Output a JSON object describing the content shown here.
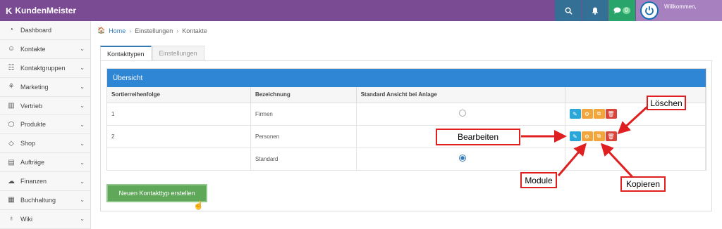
{
  "app": {
    "brand_name": "KundenMeister",
    "welcome": "Willkommen,",
    "chat_badge": "0"
  },
  "sidebar": {
    "items": [
      {
        "label": "Dashboard",
        "icon": "dashboard-icon",
        "glyph": "◔",
        "chevron": false
      },
      {
        "label": "Kontakte",
        "icon": "contacts-icon",
        "glyph": "☺",
        "chevron": true
      },
      {
        "label": "Kontaktgruppen",
        "icon": "groups-icon",
        "glyph": "☷",
        "chevron": true
      },
      {
        "label": "Marketing",
        "icon": "marketing-icon",
        "glyph": "⚘",
        "chevron": true
      },
      {
        "label": "Vertrieb",
        "icon": "sales-icon",
        "glyph": "▥",
        "chevron": true
      },
      {
        "label": "Produkte",
        "icon": "products-icon",
        "glyph": "⬡",
        "chevron": true
      },
      {
        "label": "Shop",
        "icon": "shop-icon",
        "glyph": "◇",
        "chevron": true
      },
      {
        "label": "Aufträge",
        "icon": "orders-icon",
        "glyph": "▤",
        "chevron": true
      },
      {
        "label": "Finanzen",
        "icon": "finance-icon",
        "glyph": "☁",
        "chevron": true
      },
      {
        "label": "Buchhaltung",
        "icon": "accounting-icon",
        "glyph": "▦",
        "chevron": true
      },
      {
        "label": "Wiki",
        "icon": "wiki-icon",
        "glyph": "♁",
        "chevron": true
      }
    ]
  },
  "breadcrumb": {
    "home": "Home",
    "level1": "Einstellungen",
    "level2": "Kontakte"
  },
  "tabs": {
    "active": "Kontakttypen",
    "inactive": "Einstellungen"
  },
  "box": {
    "title": "Übersicht",
    "columns": [
      "Sortierreihenfolge",
      "Bezeichnung",
      "Standard Ansicht bei Anlage",
      ""
    ],
    "rows": [
      {
        "order": "1",
        "name": "Firmen",
        "default": false,
        "actions": true
      },
      {
        "order": "2",
        "name": "Personen",
        "default": false,
        "actions": true
      },
      {
        "order": "",
        "name": "Standard",
        "default": true,
        "actions": false
      }
    ]
  },
  "create_button": "Neuen Kontakttyp erstellen",
  "annotations": {
    "delete": "Löschen",
    "edit": "Bearbeiten",
    "modules": "Module",
    "copy": "Kopieren"
  },
  "colors": {
    "topbar": "#7a4a93",
    "header_blue": "#2e86d4",
    "edit": "#2aa6d9",
    "modules": "#f2a53b",
    "delete": "#d9453a",
    "create": "#5fa85a",
    "callout": "#e02020"
  }
}
